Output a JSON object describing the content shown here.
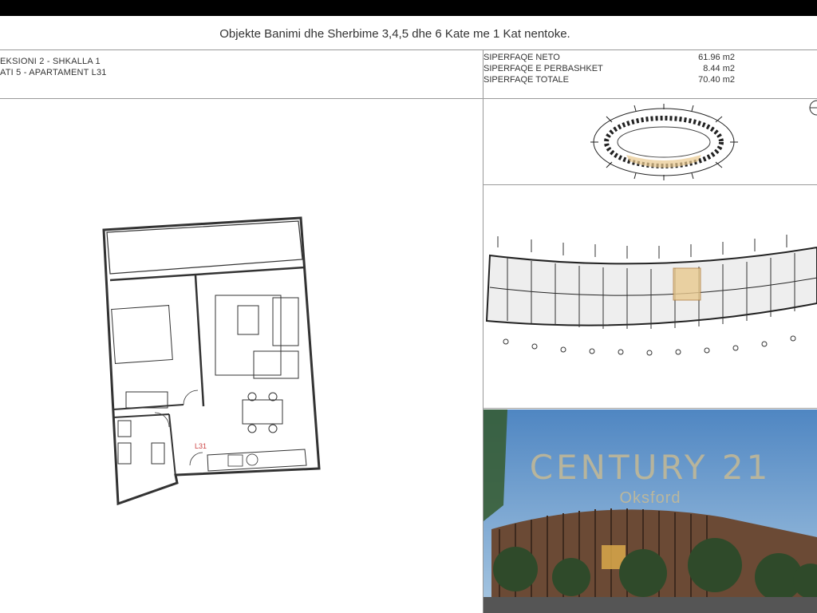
{
  "header": {
    "title": "Objekte Banimi dhe Sherbime 3,4,5 dhe 6 Kate me 1 Kat nentoke."
  },
  "unit_info": {
    "section": "EKSIONI 2 - SHKALLA 1",
    "floor_apartment": "ATI 5 - APARTAMENT L31"
  },
  "areas": [
    {
      "label": "SIPERFAQE NETO",
      "value": "61.96 m2"
    },
    {
      "label": "SIPERFAQE E PERBASHKET",
      "value": "8.44 m2"
    },
    {
      "label": "SIPERFAQE TOTALE",
      "value": "70.40 m2"
    }
  ],
  "floorplan": {
    "apartment_tag": "L31"
  },
  "watermark": {
    "brand": "CENTURY 21",
    "office": "Oksford"
  },
  "colors": {
    "highlight": "#e9c98f",
    "sky": "#4f86c2",
    "building": "#6b4a35"
  }
}
